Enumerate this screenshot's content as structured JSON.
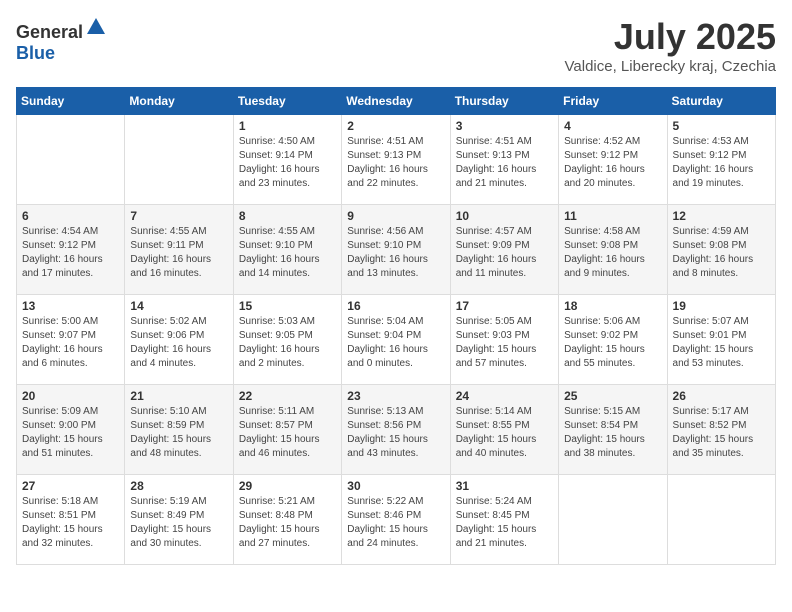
{
  "header": {
    "logo_general": "General",
    "logo_blue": "Blue",
    "month_title": "July 2025",
    "location": "Valdice, Liberecky kraj, Czechia"
  },
  "weekdays": [
    "Sunday",
    "Monday",
    "Tuesday",
    "Wednesday",
    "Thursday",
    "Friday",
    "Saturday"
  ],
  "weeks": [
    [
      {
        "day": "",
        "info": ""
      },
      {
        "day": "",
        "info": ""
      },
      {
        "day": "1",
        "info": "Sunrise: 4:50 AM\nSunset: 9:14 PM\nDaylight: 16 hours\nand 23 minutes."
      },
      {
        "day": "2",
        "info": "Sunrise: 4:51 AM\nSunset: 9:13 PM\nDaylight: 16 hours\nand 22 minutes."
      },
      {
        "day": "3",
        "info": "Sunrise: 4:51 AM\nSunset: 9:13 PM\nDaylight: 16 hours\nand 21 minutes."
      },
      {
        "day": "4",
        "info": "Sunrise: 4:52 AM\nSunset: 9:12 PM\nDaylight: 16 hours\nand 20 minutes."
      },
      {
        "day": "5",
        "info": "Sunrise: 4:53 AM\nSunset: 9:12 PM\nDaylight: 16 hours\nand 19 minutes."
      }
    ],
    [
      {
        "day": "6",
        "info": "Sunrise: 4:54 AM\nSunset: 9:12 PM\nDaylight: 16 hours\nand 17 minutes."
      },
      {
        "day": "7",
        "info": "Sunrise: 4:55 AM\nSunset: 9:11 PM\nDaylight: 16 hours\nand 16 minutes."
      },
      {
        "day": "8",
        "info": "Sunrise: 4:55 AM\nSunset: 9:10 PM\nDaylight: 16 hours\nand 14 minutes."
      },
      {
        "day": "9",
        "info": "Sunrise: 4:56 AM\nSunset: 9:10 PM\nDaylight: 16 hours\nand 13 minutes."
      },
      {
        "day": "10",
        "info": "Sunrise: 4:57 AM\nSunset: 9:09 PM\nDaylight: 16 hours\nand 11 minutes."
      },
      {
        "day": "11",
        "info": "Sunrise: 4:58 AM\nSunset: 9:08 PM\nDaylight: 16 hours\nand 9 minutes."
      },
      {
        "day": "12",
        "info": "Sunrise: 4:59 AM\nSunset: 9:08 PM\nDaylight: 16 hours\nand 8 minutes."
      }
    ],
    [
      {
        "day": "13",
        "info": "Sunrise: 5:00 AM\nSunset: 9:07 PM\nDaylight: 16 hours\nand 6 minutes."
      },
      {
        "day": "14",
        "info": "Sunrise: 5:02 AM\nSunset: 9:06 PM\nDaylight: 16 hours\nand 4 minutes."
      },
      {
        "day": "15",
        "info": "Sunrise: 5:03 AM\nSunset: 9:05 PM\nDaylight: 16 hours\nand 2 minutes."
      },
      {
        "day": "16",
        "info": "Sunrise: 5:04 AM\nSunset: 9:04 PM\nDaylight: 16 hours\nand 0 minutes."
      },
      {
        "day": "17",
        "info": "Sunrise: 5:05 AM\nSunset: 9:03 PM\nDaylight: 15 hours\nand 57 minutes."
      },
      {
        "day": "18",
        "info": "Sunrise: 5:06 AM\nSunset: 9:02 PM\nDaylight: 15 hours\nand 55 minutes."
      },
      {
        "day": "19",
        "info": "Sunrise: 5:07 AM\nSunset: 9:01 PM\nDaylight: 15 hours\nand 53 minutes."
      }
    ],
    [
      {
        "day": "20",
        "info": "Sunrise: 5:09 AM\nSunset: 9:00 PM\nDaylight: 15 hours\nand 51 minutes."
      },
      {
        "day": "21",
        "info": "Sunrise: 5:10 AM\nSunset: 8:59 PM\nDaylight: 15 hours\nand 48 minutes."
      },
      {
        "day": "22",
        "info": "Sunrise: 5:11 AM\nSunset: 8:57 PM\nDaylight: 15 hours\nand 46 minutes."
      },
      {
        "day": "23",
        "info": "Sunrise: 5:13 AM\nSunset: 8:56 PM\nDaylight: 15 hours\nand 43 minutes."
      },
      {
        "day": "24",
        "info": "Sunrise: 5:14 AM\nSunset: 8:55 PM\nDaylight: 15 hours\nand 40 minutes."
      },
      {
        "day": "25",
        "info": "Sunrise: 5:15 AM\nSunset: 8:54 PM\nDaylight: 15 hours\nand 38 minutes."
      },
      {
        "day": "26",
        "info": "Sunrise: 5:17 AM\nSunset: 8:52 PM\nDaylight: 15 hours\nand 35 minutes."
      }
    ],
    [
      {
        "day": "27",
        "info": "Sunrise: 5:18 AM\nSunset: 8:51 PM\nDaylight: 15 hours\nand 32 minutes."
      },
      {
        "day": "28",
        "info": "Sunrise: 5:19 AM\nSunset: 8:49 PM\nDaylight: 15 hours\nand 30 minutes."
      },
      {
        "day": "29",
        "info": "Sunrise: 5:21 AM\nSunset: 8:48 PM\nDaylight: 15 hours\nand 27 minutes."
      },
      {
        "day": "30",
        "info": "Sunrise: 5:22 AM\nSunset: 8:46 PM\nDaylight: 15 hours\nand 24 minutes."
      },
      {
        "day": "31",
        "info": "Sunrise: 5:24 AM\nSunset: 8:45 PM\nDaylight: 15 hours\nand 21 minutes."
      },
      {
        "day": "",
        "info": ""
      },
      {
        "day": "",
        "info": ""
      }
    ]
  ]
}
